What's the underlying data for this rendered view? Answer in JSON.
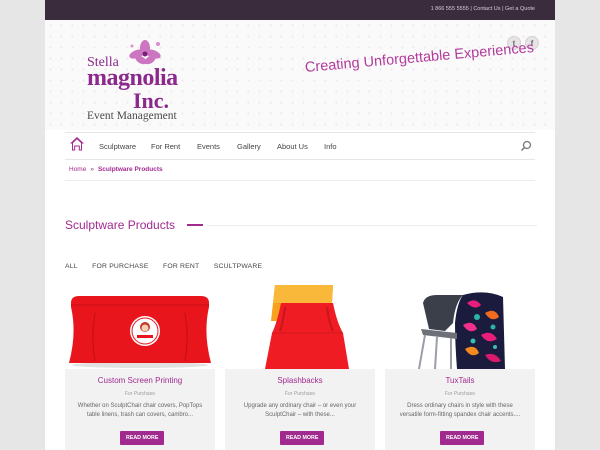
{
  "topbar": {
    "phone": "1 866 555 5555",
    "contact_label": "Contact Us",
    "quote_label": "Get a Quote"
  },
  "social": {
    "twitter_icon": "twitter-icon",
    "facebook_icon": "facebook-icon",
    "twitter_glyph": "t",
    "facebook_glyph": "f"
  },
  "logo": {
    "line1": "Stella",
    "line2": "magnolia",
    "line3": "Inc.",
    "line4": "Event Management"
  },
  "tagline": "Creating Unforgettable Experiences",
  "nav": {
    "items": [
      {
        "label": "Sculptware"
      },
      {
        "label": "For Rent"
      },
      {
        "label": "Events"
      },
      {
        "label": "Gallery"
      },
      {
        "label": "About Us"
      },
      {
        "label": "Info"
      }
    ]
  },
  "breadcrumb": {
    "home": "Home",
    "separator": "»",
    "current": "Sculptware Products"
  },
  "section_title": "Sculptware Products",
  "filters": [
    "ALL",
    "FOR PURCHASE",
    "FOR RENT",
    "SCULTPWARE"
  ],
  "products": [
    {
      "title": "Custom Screen Printing",
      "category": "For Purchase",
      "desc1": "Whether on SculptChair chair covers, PopTops",
      "desc2": "table linens, trash can covers, cambro...",
      "button": "READ MORE"
    },
    {
      "title": "Splashbacks",
      "category": "For Purchase",
      "desc1": "Upgrade any ordinary chair – or even your",
      "desc2": "SculptChair – with these...",
      "button": "READ MORE"
    },
    {
      "title": "TuxTails",
      "category": "For Purchase",
      "desc1": "Dress ordinary chairs in style with these",
      "desc2": "versatile form-fitting spandex chair accents....",
      "button": "READ MORE"
    }
  ],
  "colors": {
    "brand": "#a12a8f",
    "topbar": "#3b2c3d",
    "tagline": "#b23a9b"
  }
}
